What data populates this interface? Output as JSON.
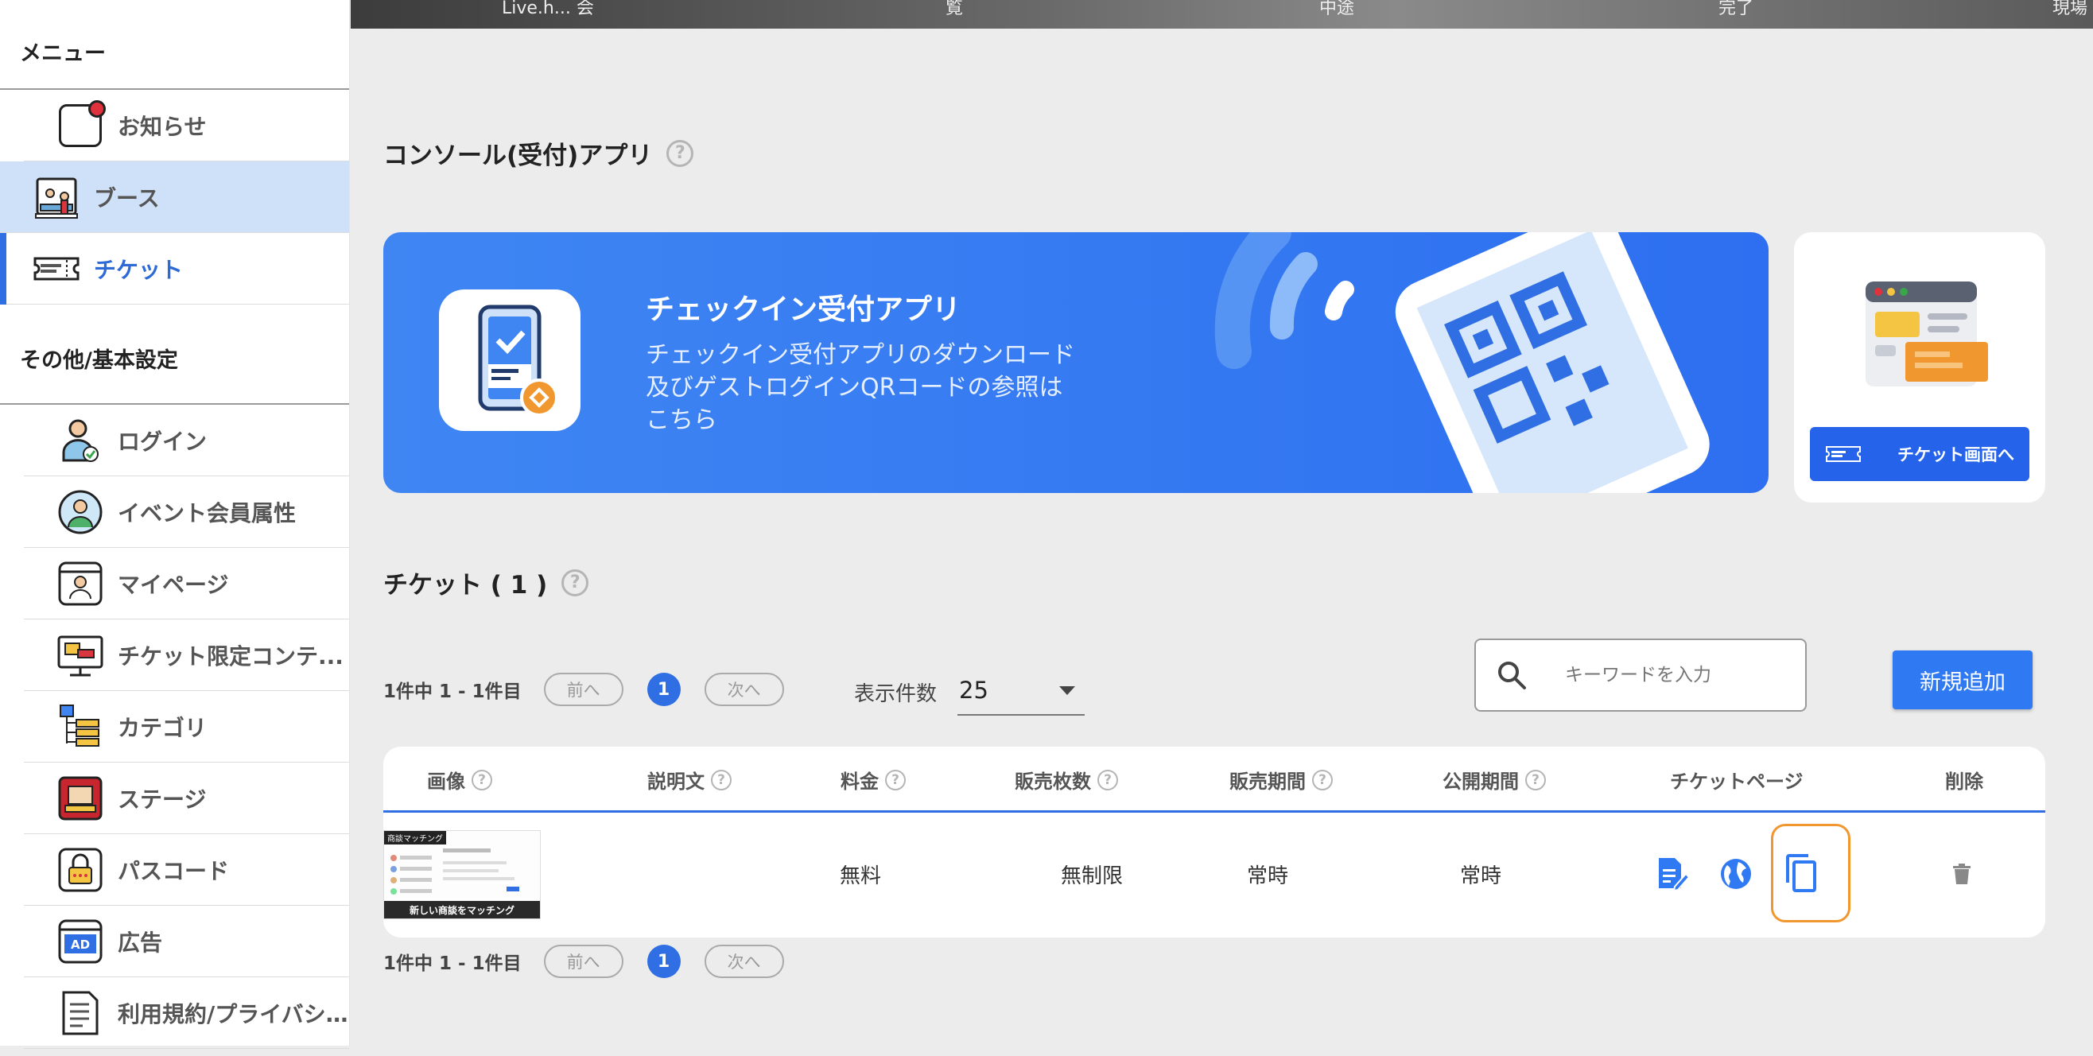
{
  "sidebar": {
    "menu_heading": "メニュー",
    "items_top": [
      {
        "label": "お知らせ"
      },
      {
        "label": "ブース"
      },
      {
        "label": "チケット"
      }
    ],
    "settings_heading": "その他/基本設定",
    "items_bottom": [
      {
        "label": "ログイン"
      },
      {
        "label": "イベント会員属性"
      },
      {
        "label": "マイページ"
      },
      {
        "label": "チケット限定コンテ..."
      },
      {
        "label": "カテゴリ"
      },
      {
        "label": "ステージ"
      },
      {
        "label": "パスコード"
      },
      {
        "label": "広告"
      },
      {
        "label": "利用規約/プライバシ..."
      }
    ]
  },
  "top_strip": {
    "texts": [
      "Live.h... 会",
      "覧",
      "中途",
      "完了",
      "現場"
    ]
  },
  "console": {
    "title": "コンソール(受付)アプリ",
    "help": "?",
    "promo_title": "チェックイン受付アプリ",
    "promo_desc_1": "チェックイン受付アプリのダウンロード",
    "promo_desc_2": "及びゲストログインQRコードの参照は",
    "promo_desc_3": "こちら",
    "ticket_button": "チケット画面へ"
  },
  "tickets": {
    "title": "チケット ( 1 )",
    "help": "?",
    "pager_summary": "1件中 1 - 1件目",
    "prev": "前へ",
    "next": "次へ",
    "page": "1",
    "per_page_label": "表示件数",
    "per_page_value": "25",
    "search_placeholder": "キーワードを入力",
    "new_button": "新規追加",
    "columns": {
      "image": "画像",
      "description": "説明文",
      "price": "料金",
      "sold": "販売枚数",
      "sales_period": "販売期間",
      "public_period": "公開期間",
      "ticket_page": "チケットページ",
      "delete": "削除"
    },
    "rows": [
      {
        "thumb_tag": "商談マッチング",
        "thumb_caption": "新しい商談をマッチング",
        "description": "",
        "price": "無料",
        "sold": "無制限",
        "sales_period": "常時",
        "public_period": "常時"
      }
    ]
  },
  "colors": {
    "accent": "#2f6fe3",
    "highlight": "#f0982f",
    "selected_bg": "#cfe1f8"
  }
}
